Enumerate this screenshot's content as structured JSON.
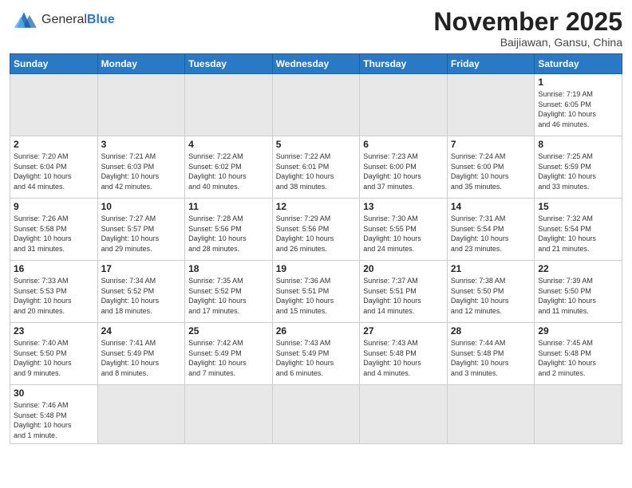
{
  "header": {
    "logo_general": "General",
    "logo_blue": "Blue",
    "month_title": "November 2025",
    "location": "Baijiawan, Gansu, China"
  },
  "days_of_week": [
    "Sunday",
    "Monday",
    "Tuesday",
    "Wednesday",
    "Thursday",
    "Friday",
    "Saturday"
  ],
  "weeks": [
    [
      {
        "day": "",
        "info": "",
        "empty": true
      },
      {
        "day": "",
        "info": "",
        "empty": true
      },
      {
        "day": "",
        "info": "",
        "empty": true
      },
      {
        "day": "",
        "info": "",
        "empty": true
      },
      {
        "day": "",
        "info": "",
        "empty": true
      },
      {
        "day": "",
        "info": "",
        "empty": true
      },
      {
        "day": "1",
        "info": "Sunrise: 7:19 AM\nSunset: 6:05 PM\nDaylight: 10 hours\nand 46 minutes."
      }
    ],
    [
      {
        "day": "2",
        "info": "Sunrise: 7:20 AM\nSunset: 6:04 PM\nDaylight: 10 hours\nand 44 minutes."
      },
      {
        "day": "3",
        "info": "Sunrise: 7:21 AM\nSunset: 6:03 PM\nDaylight: 10 hours\nand 42 minutes."
      },
      {
        "day": "4",
        "info": "Sunrise: 7:22 AM\nSunset: 6:02 PM\nDaylight: 10 hours\nand 40 minutes."
      },
      {
        "day": "5",
        "info": "Sunrise: 7:22 AM\nSunset: 6:01 PM\nDaylight: 10 hours\nand 38 minutes."
      },
      {
        "day": "6",
        "info": "Sunrise: 7:23 AM\nSunset: 6:00 PM\nDaylight: 10 hours\nand 37 minutes."
      },
      {
        "day": "7",
        "info": "Sunrise: 7:24 AM\nSunset: 6:00 PM\nDaylight: 10 hours\nand 35 minutes."
      },
      {
        "day": "8",
        "info": "Sunrise: 7:25 AM\nSunset: 5:59 PM\nDaylight: 10 hours\nand 33 minutes."
      }
    ],
    [
      {
        "day": "9",
        "info": "Sunrise: 7:26 AM\nSunset: 5:58 PM\nDaylight: 10 hours\nand 31 minutes."
      },
      {
        "day": "10",
        "info": "Sunrise: 7:27 AM\nSunset: 5:57 PM\nDaylight: 10 hours\nand 29 minutes."
      },
      {
        "day": "11",
        "info": "Sunrise: 7:28 AM\nSunset: 5:56 PM\nDaylight: 10 hours\nand 28 minutes."
      },
      {
        "day": "12",
        "info": "Sunrise: 7:29 AM\nSunset: 5:56 PM\nDaylight: 10 hours\nand 26 minutes."
      },
      {
        "day": "13",
        "info": "Sunrise: 7:30 AM\nSunset: 5:55 PM\nDaylight: 10 hours\nand 24 minutes."
      },
      {
        "day": "14",
        "info": "Sunrise: 7:31 AM\nSunset: 5:54 PM\nDaylight: 10 hours\nand 23 minutes."
      },
      {
        "day": "15",
        "info": "Sunrise: 7:32 AM\nSunset: 5:54 PM\nDaylight: 10 hours\nand 21 minutes."
      }
    ],
    [
      {
        "day": "16",
        "info": "Sunrise: 7:33 AM\nSunset: 5:53 PM\nDaylight: 10 hours\nand 20 minutes."
      },
      {
        "day": "17",
        "info": "Sunrise: 7:34 AM\nSunset: 5:52 PM\nDaylight: 10 hours\nand 18 minutes."
      },
      {
        "day": "18",
        "info": "Sunrise: 7:35 AM\nSunset: 5:52 PM\nDaylight: 10 hours\nand 17 minutes."
      },
      {
        "day": "19",
        "info": "Sunrise: 7:36 AM\nSunset: 5:51 PM\nDaylight: 10 hours\nand 15 minutes."
      },
      {
        "day": "20",
        "info": "Sunrise: 7:37 AM\nSunset: 5:51 PM\nDaylight: 10 hours\nand 14 minutes."
      },
      {
        "day": "21",
        "info": "Sunrise: 7:38 AM\nSunset: 5:50 PM\nDaylight: 10 hours\nand 12 minutes."
      },
      {
        "day": "22",
        "info": "Sunrise: 7:39 AM\nSunset: 5:50 PM\nDaylight: 10 hours\nand 11 minutes."
      }
    ],
    [
      {
        "day": "23",
        "info": "Sunrise: 7:40 AM\nSunset: 5:50 PM\nDaylight: 10 hours\nand 9 minutes."
      },
      {
        "day": "24",
        "info": "Sunrise: 7:41 AM\nSunset: 5:49 PM\nDaylight: 10 hours\nand 8 minutes."
      },
      {
        "day": "25",
        "info": "Sunrise: 7:42 AM\nSunset: 5:49 PM\nDaylight: 10 hours\nand 7 minutes."
      },
      {
        "day": "26",
        "info": "Sunrise: 7:43 AM\nSunset: 5:49 PM\nDaylight: 10 hours\nand 6 minutes."
      },
      {
        "day": "27",
        "info": "Sunrise: 7:43 AM\nSunset: 5:48 PM\nDaylight: 10 hours\nand 4 minutes."
      },
      {
        "day": "28",
        "info": "Sunrise: 7:44 AM\nSunset: 5:48 PM\nDaylight: 10 hours\nand 3 minutes."
      },
      {
        "day": "29",
        "info": "Sunrise: 7:45 AM\nSunset: 5:48 PM\nDaylight: 10 hours\nand 2 minutes."
      }
    ],
    [
      {
        "day": "30",
        "info": "Sunrise: 7:46 AM\nSunset: 5:48 PM\nDaylight: 10 hours\nand 1 minute.",
        "lastrow": true
      },
      {
        "day": "",
        "info": "",
        "empty": true,
        "lastrow": true
      },
      {
        "day": "",
        "info": "",
        "empty": true,
        "lastrow": true
      },
      {
        "day": "",
        "info": "",
        "empty": true,
        "lastrow": true
      },
      {
        "day": "",
        "info": "",
        "empty": true,
        "lastrow": true
      },
      {
        "day": "",
        "info": "",
        "empty": true,
        "lastrow": true
      },
      {
        "day": "",
        "info": "",
        "empty": true,
        "lastrow": true
      }
    ]
  ]
}
